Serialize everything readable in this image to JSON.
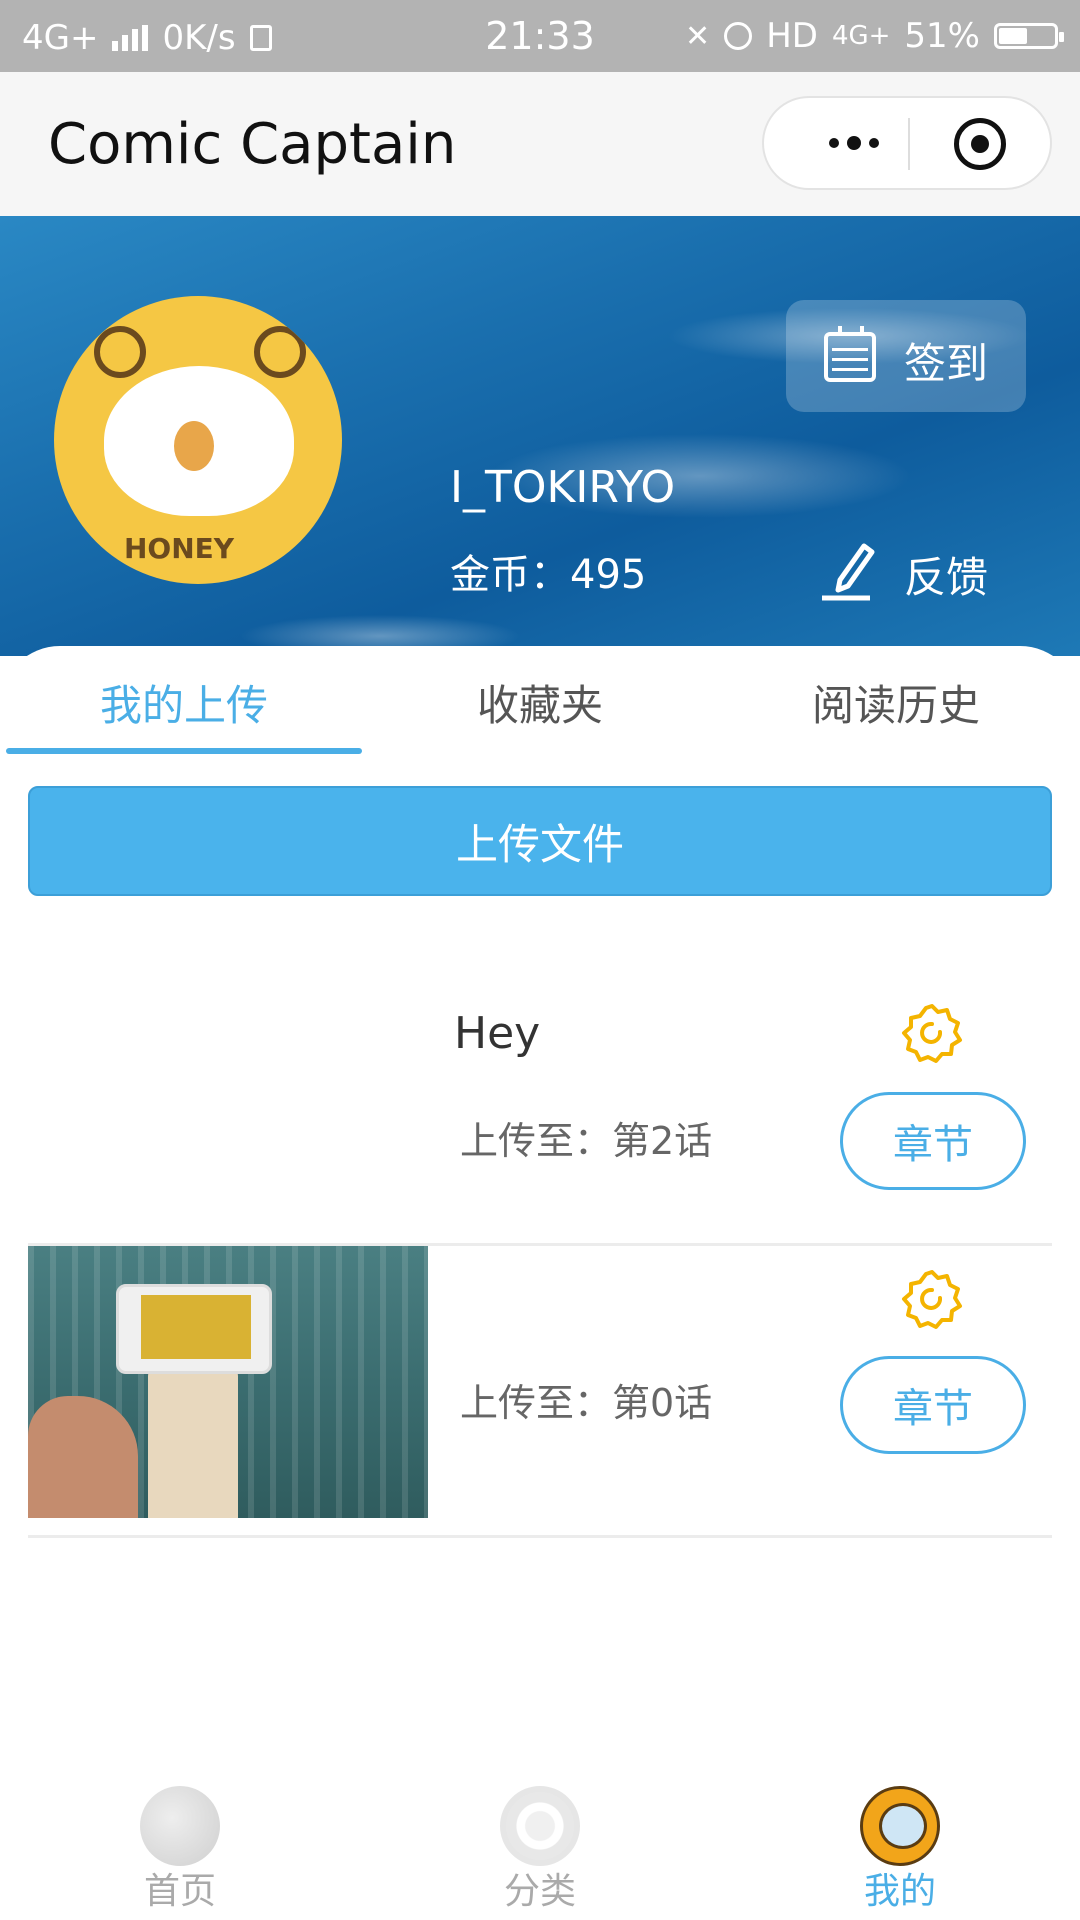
{
  "status_bar": {
    "network": "4G+",
    "speed": "0K/s",
    "time": "21:33",
    "hd_label": "HD",
    "network2": "4G+",
    "battery": "51%",
    "battery_level": 0.51
  },
  "app": {
    "title": "Comic Captain"
  },
  "profile": {
    "username": "I_TOKIRYO",
    "coins_label": "金币：495",
    "checkin_label": "签到",
    "feedback_label": "反馈",
    "avatar_text": "HONEY"
  },
  "tabs": [
    {
      "label": "我的上传",
      "active": true
    },
    {
      "label": "收藏夹",
      "active": false
    },
    {
      "label": "阅读历史",
      "active": false
    }
  ],
  "upload_button_label": "上传文件",
  "uploads": [
    {
      "title": "Hey",
      "subtitle": "上传至：第2话",
      "chapter_label": "章节"
    },
    {
      "title": "",
      "subtitle": "上传至：第0话",
      "chapter_label": "章节"
    }
  ],
  "bottom_nav": [
    {
      "label": "首页",
      "icon": "planet-icon",
      "active": false
    },
    {
      "label": "分类",
      "icon": "orbit-icon",
      "active": false
    },
    {
      "label": "我的",
      "icon": "astronaut-icon",
      "active": true
    }
  ],
  "colors": {
    "accent": "#4aaee6",
    "upload_button": "#4ab3ec",
    "gear": "#f4b400"
  }
}
